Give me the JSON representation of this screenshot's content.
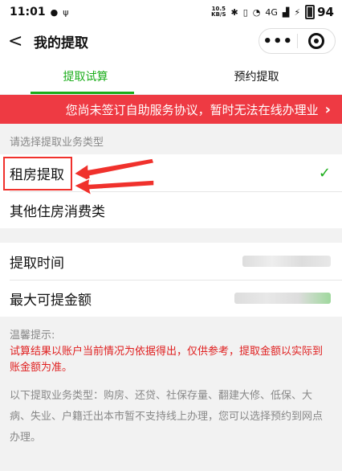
{
  "status": {
    "time": "11:01",
    "speed_top": "10.5",
    "speed_bottom": "KB/S",
    "network": "4G",
    "battery": "94"
  },
  "nav": {
    "back_icon": "chevron-left-icon",
    "title": "我的提取",
    "more": "•••"
  },
  "tabs": [
    {
      "label": "提取试算",
      "active": true
    },
    {
      "label": "预约提取",
      "active": false
    }
  ],
  "banner": {
    "text": "您尚未签订自助服务协议，暂时无法在线办理业",
    "arrow": "›"
  },
  "section": {
    "label": "请选择提取业务类型"
  },
  "types": [
    {
      "label": "租房提取",
      "selected": true
    },
    {
      "label": "其他住房消费类",
      "selected": false
    }
  ],
  "check": "✓",
  "fields": [
    {
      "label": "提取时间"
    },
    {
      "label": "最大可提金额"
    }
  ],
  "tips": {
    "title": "温馨提示:",
    "warning": "试算结果以账户当前情况为依据得出，仅供参考，提取金额以实际到账金额为准。",
    "note": "以下提取业务类型：购房、还贷、社保存量、翻建大修、低保、大病、失业、户籍迁出本市暂不支持线上办理，您可以选择预约到网点办理。"
  },
  "colors": {
    "accent": "#1aad19",
    "banner": "#ee3a43",
    "annotation": "#f0312c"
  }
}
